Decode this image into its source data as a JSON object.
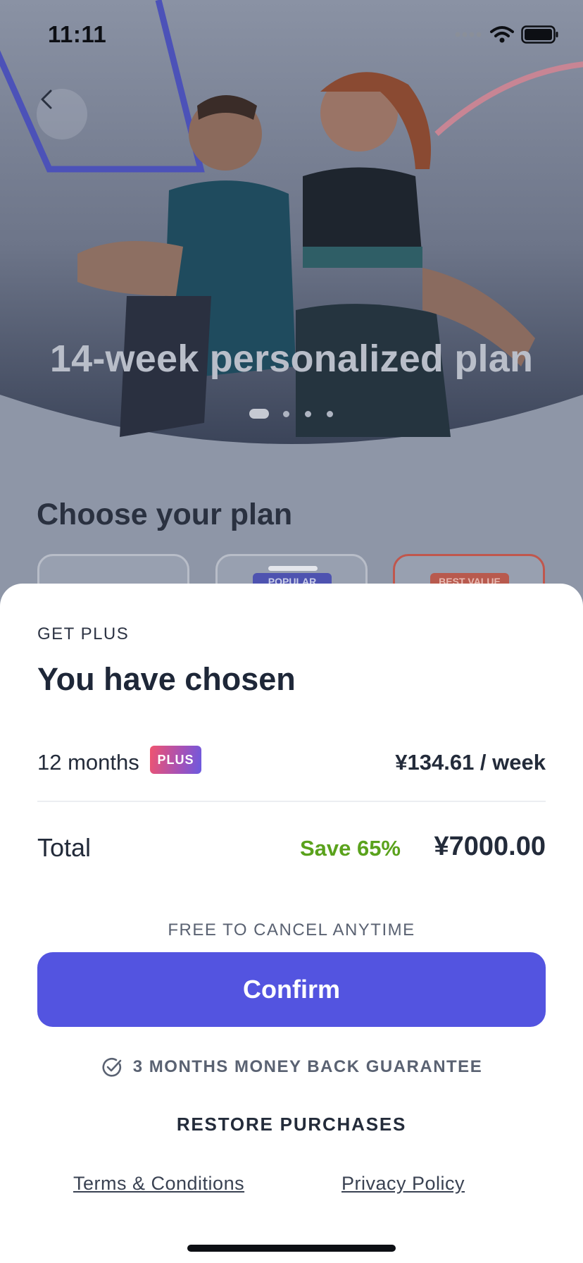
{
  "status_bar": {
    "time": "11:11"
  },
  "hero": {
    "title": "14-week personalized plan",
    "carousel_pages": 4,
    "carousel_active_index": 0
  },
  "plans_section": {
    "title": "Choose your plan",
    "cards": [
      {
        "tag": ""
      },
      {
        "tag": "POPULAR"
      },
      {
        "tag": "BEST VALUE"
      }
    ]
  },
  "sheet": {
    "kicker": "GET PLUS",
    "title": "You have chosen",
    "plan": {
      "name": "12 months",
      "badge": "PLUS",
      "price": "¥134.61 / week"
    },
    "total": {
      "label": "Total",
      "save": "Save 65%",
      "price": "¥7000.00"
    },
    "cancel_note": "FREE TO CANCEL ANYTIME",
    "confirm_label": "Confirm",
    "guarantee": "3 MONTHS MONEY BACK GUARANTEE",
    "restore_label": "RESTORE PURCHASES",
    "terms_label": "Terms & Conditions",
    "privacy_label": "Privacy Policy"
  },
  "colors": {
    "accent": "#5354e0",
    "save_green": "#5aa21c",
    "best_value_border": "#c0574d",
    "plus_badge_gradient": [
      "#f0546f",
      "#6a5ae0"
    ]
  },
  "icons": {
    "back": "chevron-left-icon",
    "guarantee": "check-circle-icon",
    "signal": "signal-icon",
    "wifi": "wifi-icon",
    "battery": "battery-icon"
  }
}
